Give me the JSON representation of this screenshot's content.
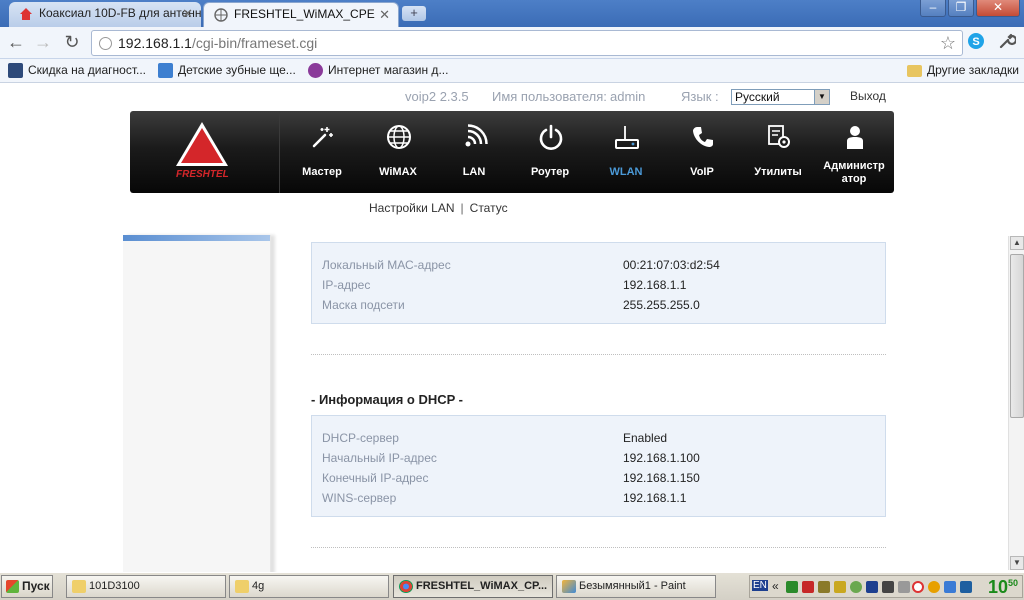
{
  "browser": {
    "tabs": [
      {
        "title": "Коаксиал 10D-FB для антенн",
        "active": false
      },
      {
        "title": "FRESHTEL_WiMAX_CPE",
        "active": true
      }
    ],
    "new_tab": "+",
    "window_buttons": {
      "minimize": "–",
      "maximize": "❐",
      "close": "✕"
    },
    "url": {
      "host": "192.168.1.1",
      "path": "/cgi-bin/frameset.cgi"
    },
    "bookmarks": [
      "Скидка на диагност...",
      "Детские зубные ще...",
      "Интернет магазин д..."
    ],
    "other_bookmarks": "Другие закладки"
  },
  "router": {
    "version": "voip2 2.3.5",
    "user_label": "Имя пользователя:",
    "user": "admin",
    "lang_label": "Язык :",
    "lang_value": "Русский",
    "logout": "Выход",
    "brand": "FRESHTEL",
    "menu": [
      {
        "label": "Мастер",
        "icon": "wand-icon"
      },
      {
        "label": "WiMAX",
        "icon": "globe-icon"
      },
      {
        "label": "LAN",
        "icon": "wifi-signal-icon"
      },
      {
        "label": "Роутер",
        "icon": "power-icon"
      },
      {
        "label": "WLAN",
        "icon": "wireless-router-icon",
        "selected": true
      },
      {
        "label": "VoIP",
        "icon": "phone-icon"
      },
      {
        "label": "Утилиты",
        "icon": "tools-icon"
      },
      {
        "label": "Администр атор",
        "icon": "user-icon"
      }
    ],
    "subnav": {
      "item1": "Настройки LAN",
      "separator": "|",
      "item2": "Статус"
    },
    "lan_info": [
      {
        "key": "Локальный МАС-адрес",
        "value": "00:21:07:03:d2:54"
      },
      {
        "key": "IP-адрес",
        "value": "192.168.1.1"
      },
      {
        "key": "Маска подсети",
        "value": "255.255.255.0"
      }
    ],
    "dhcp_title": "- Информация о DHCP -",
    "dhcp_info": [
      {
        "key": "DHCP-сервер",
        "value": "Enabled"
      },
      {
        "key": "Начальный IP-адрес",
        "value": "192.168.1.100"
      },
      {
        "key": "Конечный IP-адрес",
        "value": "192.168.1.150"
      },
      {
        "key": "WINS-сервер",
        "value": "192.168.1.1"
      }
    ]
  },
  "taskbar": {
    "start": "Пуск",
    "tasks": [
      {
        "label": "101D3100",
        "active": false
      },
      {
        "label": "4g",
        "active": false
      },
      {
        "label": "FRESHTEL_WiMAX_CP...",
        "active": true
      },
      {
        "label": "Безымянный1 - Paint",
        "active": false
      }
    ],
    "tray_lang": "EN",
    "tray_expand": "«",
    "clock": {
      "hours": "10",
      "minutes": "50"
    }
  },
  "colors": {
    "accent_selected": "#4b9ad8",
    "brand_red": "#d4262a",
    "panel_bg": "#eef3fa"
  }
}
